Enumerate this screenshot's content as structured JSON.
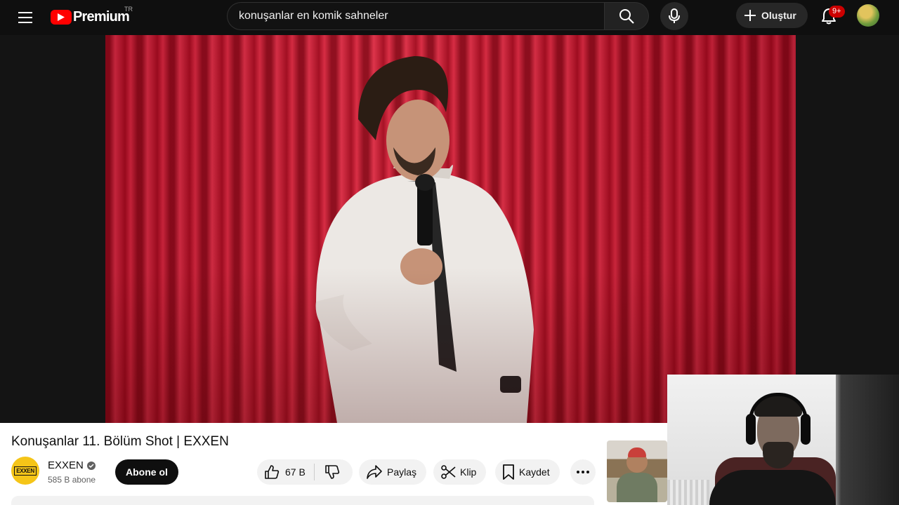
{
  "header": {
    "logo_text": "Premium",
    "logo_region": "TR",
    "search_value": "konuşanlar en komik sahneler",
    "create_label": "Oluştur",
    "notification_badge": "9+"
  },
  "video": {
    "title": "Konuşanlar 11. Bölüm Shot | EXXEN"
  },
  "channel": {
    "logo_text": "EXXEN",
    "name": "EXXEN",
    "subscribers": "585 B abone",
    "subscribe_label": "Abone ol"
  },
  "actions": {
    "like_count": "67 B",
    "share_label": "Paylaş",
    "clip_label": "Klip",
    "save_label": "Kaydet"
  },
  "colors": {
    "brand_red": "#ff0000",
    "badge_red": "#cc0000",
    "subscribe_bg": "#0f0f0f",
    "pill_bg": "#f2f2f2"
  },
  "icons": [
    "menu-icon",
    "youtube-play-icon",
    "search-icon",
    "mic-icon",
    "plus-icon",
    "bell-icon",
    "verified-icon",
    "thumbs-up-icon",
    "thumbs-down-icon",
    "share-icon",
    "scissors-icon",
    "bookmark-icon",
    "more-icon"
  ]
}
